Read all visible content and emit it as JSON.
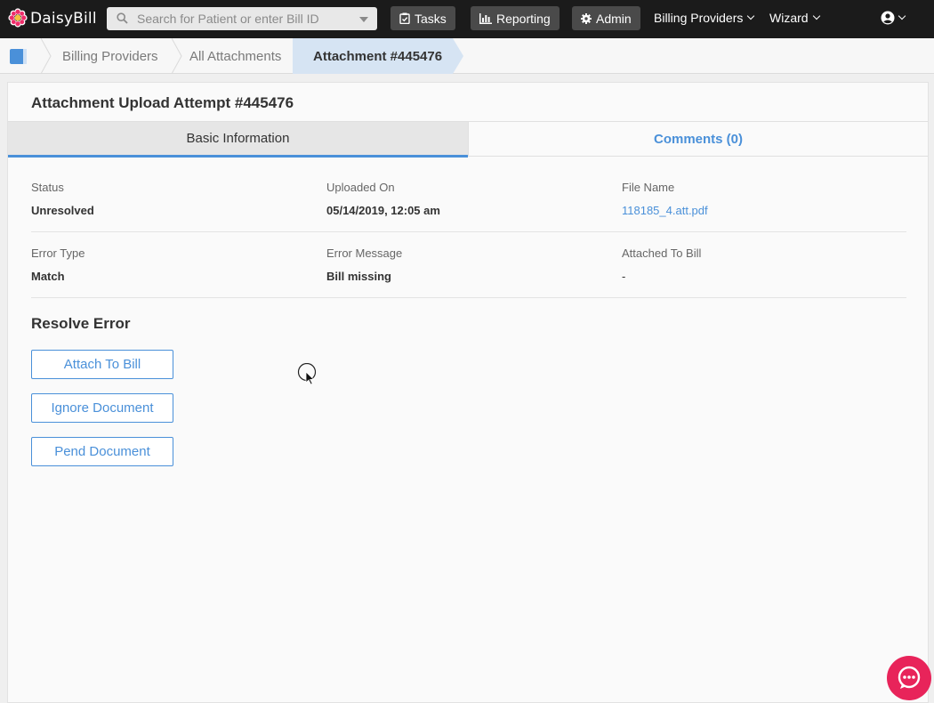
{
  "header": {
    "brand": "DaisyBill",
    "search_placeholder": "Search for Patient or enter Bill ID",
    "tasks_label": "Tasks",
    "reporting_label": "Reporting",
    "admin_label": "Admin",
    "billing_providers_label": "Billing Providers",
    "wizard_label": "Wizard"
  },
  "breadcrumb": [
    "Billing Providers",
    "All Attachments",
    "Attachment #445476"
  ],
  "page": {
    "title": "Attachment Upload Attempt #445476",
    "tabs": [
      "Basic Information",
      "Comments (0)"
    ]
  },
  "details": {
    "status_label": "Status",
    "status_value": "Unresolved",
    "uploaded_label": "Uploaded On",
    "uploaded_value": "05/14/2019, 12:05 am",
    "file_label": "File Name",
    "file_value": "118185_4.att.pdf",
    "error_type_label": "Error Type",
    "error_type_value": "Match",
    "error_message_label": "Error Message",
    "error_message_value": "Bill missing",
    "attached_label": "Attached To Bill",
    "attached_value": "-"
  },
  "resolve": {
    "title": "Resolve Error",
    "attach_button": "Attach To Bill",
    "ignore_button": "Ignore Document",
    "pend_button": "Pend Document"
  },
  "colors": {
    "accent": "#4a90d9",
    "topbar": "#1b1b1b",
    "chat": "#e8245a"
  },
  "icons": [
    "daisy-logo-icon",
    "search-icon",
    "clipboard-check-icon",
    "bar-chart-icon",
    "gear-icon",
    "user-circle-icon",
    "home-icon",
    "chat-icon",
    "mouse-cursor-icon"
  ]
}
